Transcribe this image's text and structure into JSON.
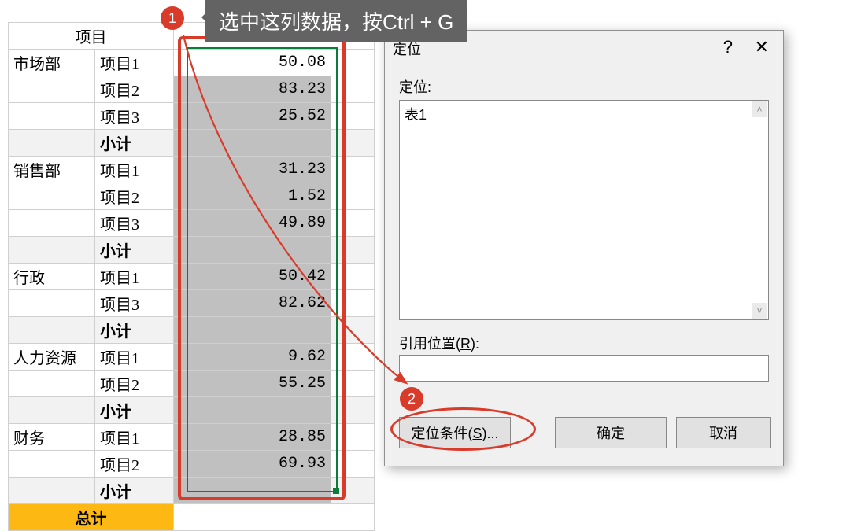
{
  "tooltip": {
    "text": "选中这列数据，按Ctrl + G"
  },
  "badges": {
    "b1": "1",
    "b2": "2"
  },
  "table": {
    "header": {
      "colspan_label": "项目"
    },
    "rows": [
      {
        "dept": "市场部",
        "item": "项目1",
        "val": "50.08",
        "sel": "active"
      },
      {
        "dept": "",
        "item": "项目2",
        "val": "83.23",
        "sel": "hl"
      },
      {
        "dept": "",
        "item": "项目3",
        "val": "25.52",
        "sel": "hl"
      },
      {
        "dept": "",
        "item": "小计",
        "val": "",
        "subtotal": true,
        "sel": "hl"
      },
      {
        "dept": "销售部",
        "item": "项目1",
        "val": "31.23",
        "sel": "hl"
      },
      {
        "dept": "",
        "item": "项目2",
        "val": "1.52",
        "sel": "hl"
      },
      {
        "dept": "",
        "item": "项目3",
        "val": "49.89",
        "sel": "hl"
      },
      {
        "dept": "",
        "item": "小计",
        "val": "",
        "subtotal": true,
        "sel": "hl"
      },
      {
        "dept": "行政",
        "item": "项目1",
        "val": "50.42",
        "sel": "hl"
      },
      {
        "dept": "",
        "item": "项目3",
        "val": "82.62",
        "sel": "hl"
      },
      {
        "dept": "",
        "item": "小计",
        "val": "",
        "subtotal": true,
        "sel": "hl"
      },
      {
        "dept": "人力资源",
        "item": "项目1",
        "val": "9.62",
        "sel": "hl"
      },
      {
        "dept": "",
        "item": "项目2",
        "val": "55.25",
        "sel": "hl"
      },
      {
        "dept": "",
        "item": "小计",
        "val": "",
        "subtotal": true,
        "sel": "hl"
      },
      {
        "dept": "财务",
        "item": "项目1",
        "val": "28.85",
        "sel": "hl"
      },
      {
        "dept": "",
        "item": "项目2",
        "val": "69.93",
        "sel": "hl"
      },
      {
        "dept": "",
        "item": "小计",
        "val": "",
        "subtotal": true,
        "sel": "hl"
      }
    ],
    "total_label": "总计"
  },
  "dialog": {
    "title": "定位",
    "help": "?",
    "close": "✕",
    "goto_label": "定位:",
    "list_item": "表1",
    "ref_label_pre": "引用位置(",
    "ref_label_key": "R",
    "ref_label_post": "):",
    "ref_value": "",
    "btn_special_pre": "定位条件(",
    "btn_special_key": "S",
    "btn_special_post": ")...",
    "btn_ok": "确定",
    "btn_cancel": "取消"
  }
}
